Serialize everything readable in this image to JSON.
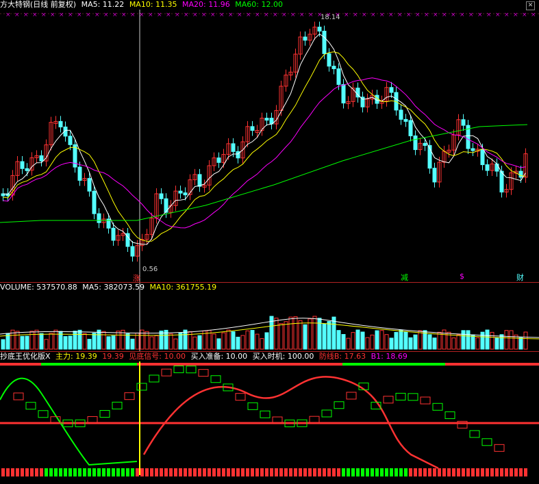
{
  "main_header": {
    "title": "方大特钢(日线 前复权)",
    "ma5": "MA5: 11.22",
    "ma10": "MA10: 11.35",
    "ma20": "MA20: 11.96",
    "ma60": "MA60: 12.00"
  },
  "main_annotations": {
    "high_label": "18.14",
    "low_label": "0.56",
    "marker_up": "涨",
    "marker_reduce": "减",
    "marker_dollar": "$",
    "marker_finance": "财"
  },
  "volume_header": {
    "label": "VOLUME: 537570.88",
    "ma5": "MA5: 382073.59",
    "ma10": "MA10: 361755.19"
  },
  "indicator_header": {
    "name": "抄底王优化版X",
    "main_force_label": "主力: 19.39",
    "main_force_value": "19.39",
    "bottom_signal": "见底信号: 10.00",
    "buy_prepare": "买入准备: 10.00",
    "buy_time": "买入时机: 100.00",
    "defense_b": "防线B: 17.63",
    "b1": "B1: 18.69"
  },
  "colors": {
    "up": "#ff3232",
    "down": "#54ffff",
    "ma5": "#ffffff",
    "ma10": "#ffff00",
    "ma20": "#ff00ff",
    "ma60": "#00ff00",
    "grid": "#b22222"
  },
  "chart_data": [
    {
      "type": "candlestick",
      "title": "方大特钢(日线 前复权)",
      "series": [
        {
          "name": "MA5",
          "last": 11.22
        },
        {
          "name": "MA10",
          "last": 11.35
        },
        {
          "name": "MA20",
          "last": 11.96
        },
        {
          "name": "MA60",
          "last": 12.0
        }
      ],
      "annotations": [
        "18.14",
        "0.56"
      ]
    },
    {
      "type": "bar",
      "title": "VOLUME",
      "series": [
        {
          "name": "VOLUME",
          "last": 537570.88
        },
        {
          "name": "MA5",
          "last": 382073.59
        },
        {
          "name": "MA10",
          "last": 361755.19
        }
      ]
    },
    {
      "type": "line",
      "title": "抄底王优化版X",
      "series": [
        {
          "name": "主力",
          "last": 19.39
        },
        {
          "name": "见底信号",
          "last": 10.0
        },
        {
          "name": "买入准备",
          "last": 10.0
        },
        {
          "name": "买入时机",
          "last": 100.0
        },
        {
          "name": "防线B",
          "last": 17.63
        },
        {
          "name": "B1",
          "last": 18.69
        }
      ]
    }
  ]
}
